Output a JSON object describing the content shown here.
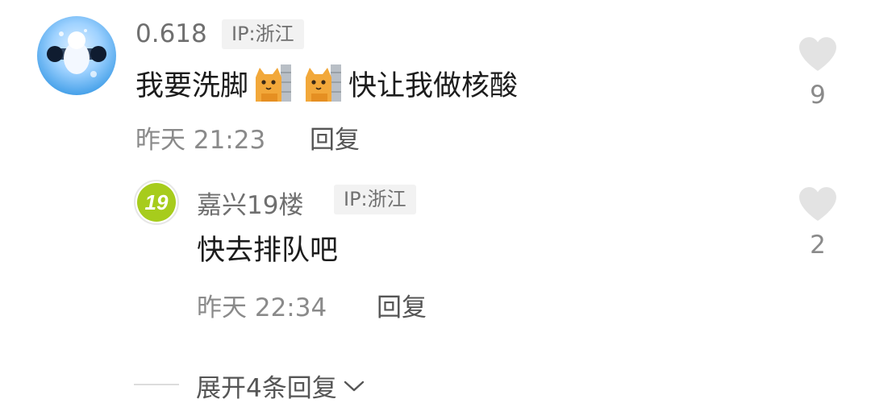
{
  "comment": {
    "username": "0.618",
    "ip": "IP:浙江",
    "text_before": "我要洗脚",
    "emojis": [
      "cat-peek-emoji",
      "cat-peek-emoji"
    ],
    "text_after": "快让我做核酸",
    "time": "昨天 21:23",
    "reply_label": "回复",
    "likes": "9"
  },
  "reply": {
    "avatar_text": "19",
    "username": "嘉兴19楼",
    "ip": "IP:浙江",
    "text": "快去排队吧",
    "time": "昨天 22:34",
    "reply_label": "回复",
    "likes": "2"
  },
  "expand": {
    "label": "展开4条回复"
  },
  "colors": {
    "like_icon": "#e3e3e3",
    "sub_avatar_green": "#a7cc1c"
  }
}
